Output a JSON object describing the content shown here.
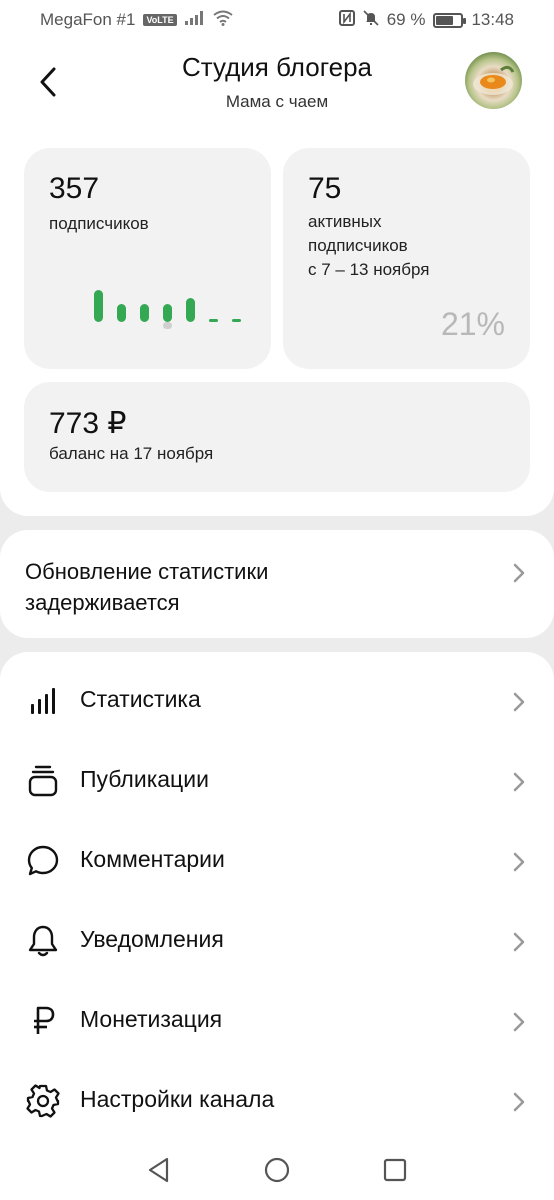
{
  "status_bar": {
    "carrier": "MegaFon #1",
    "volte": "VoLTE",
    "battery": "69 %",
    "battery_level": 0.69,
    "time": "13:48"
  },
  "header": {
    "title": "Студия блогера",
    "subtitle": "Мама с чаем"
  },
  "stats": {
    "subscribers": {
      "value": "357",
      "label": "подписчиков",
      "chart_values": [
        1.0,
        0.55,
        0.55,
        0.55,
        0.75,
        0.1,
        0.1
      ]
    },
    "active": {
      "value": "75",
      "label_lines": [
        "активных",
        "подписчиков",
        "с 7 – 13 ноября"
      ],
      "percent": "21%"
    },
    "balance": {
      "value": "773 ₽",
      "label": "баланс на 17 ноября"
    }
  },
  "notice": {
    "line1": "Обновление статистики",
    "line2": "задерживается"
  },
  "menu": [
    {
      "label": "Статистика",
      "icon": "bar-chart-icon"
    },
    {
      "label": "Публикации",
      "icon": "stack-icon"
    },
    {
      "label": "Комментарии",
      "icon": "comment-icon"
    },
    {
      "label": "Уведомления",
      "icon": "bell-icon"
    },
    {
      "label": "Монетизация",
      "icon": "ruble-icon"
    },
    {
      "label": "Настройки канала",
      "icon": "gear-icon"
    }
  ],
  "colors": {
    "accent_green": "#34a853",
    "card_bg": "#f2f2f2",
    "page_bg": "#ececec"
  }
}
